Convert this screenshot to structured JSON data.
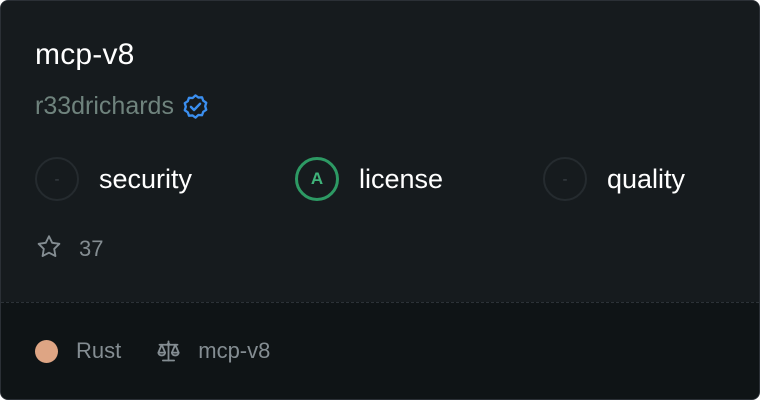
{
  "repo": {
    "name": "mcp-v8",
    "owner": "r33drichards",
    "owner_verified": true
  },
  "scores": [
    {
      "grade": "-",
      "label": "security",
      "color": "#3c4348"
    },
    {
      "grade": "A",
      "label": "license",
      "color": "#2d9a64"
    },
    {
      "grade": "-",
      "label": "quality",
      "color": "#3c4348"
    }
  ],
  "stats": {
    "stars": "37"
  },
  "footer": {
    "language": "Rust",
    "language_color": "#dea584",
    "license": "mcp-v8"
  },
  "icons": {
    "verified": "verified-badge-icon",
    "star": "star-icon",
    "license": "scale-icon"
  }
}
